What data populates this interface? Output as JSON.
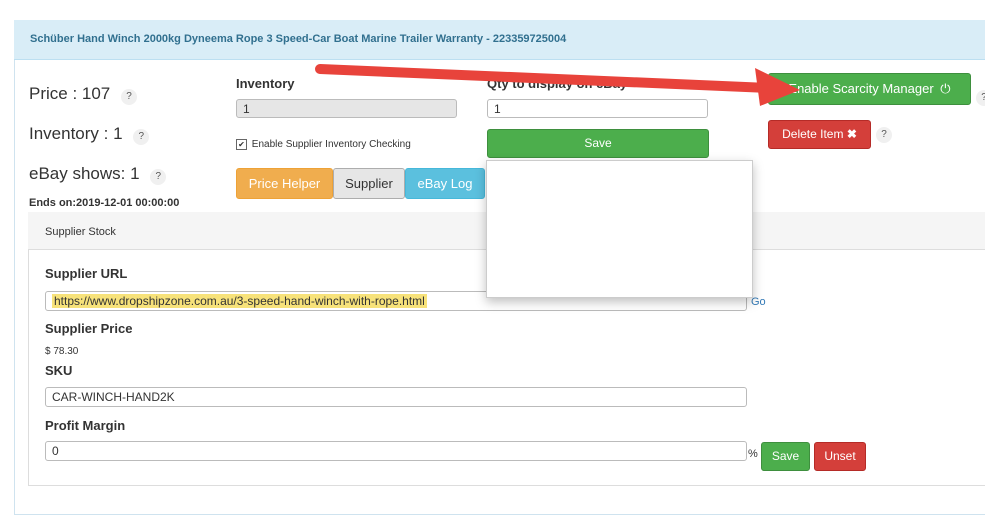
{
  "header": {
    "title": "Schüber Hand Winch 2000kg Dyneema Rope 3 Speed-Car Boat Marine Trailer Warranty - 223359725004"
  },
  "summary": {
    "price_text": "Price : 107",
    "inventory_text": "Inventory : 1",
    "ebay_shows_text": "eBay shows: 1",
    "help": "?",
    "ends_on": "Ends on:2019-12-01 00:00:00"
  },
  "inventory": {
    "label": "Inventory",
    "value": "1",
    "checkbox_label": "Enable Supplier Inventory Checking"
  },
  "qty": {
    "label": "Qty to display on eBay",
    "value": "1",
    "save_label": "Save"
  },
  "tabs": [
    "Price Helper",
    "Supplier",
    "eBay Log"
  ],
  "actions": {
    "scarcity_label": "Enable Scarcity Manager",
    "delete_label": "Delete Item"
  },
  "supplier": {
    "panel_title": "Supplier Stock",
    "url_label": "Supplier URL",
    "url_value": "https://www.dropshipzone.com.au/3-speed-hand-winch-with-rope.html",
    "go_label": "Go",
    "price_label": "Supplier Price",
    "price_value": "$ 78.30",
    "sku_label": "SKU",
    "sku_value": "CAR-WINCH-HAND2K",
    "margin_label": "Profit Margin",
    "margin_value": "0",
    "percent": "%",
    "save_label": "Save",
    "unset_label": "Unset"
  },
  "colors": {
    "header_bg": "#d9edf7",
    "header_text": "#31708f",
    "green": "#4cae4c",
    "red": "#d43f3a",
    "orange": "#f0ad4e",
    "blue": "#5bc0de",
    "arrow": "#e8433b",
    "highlight": "#f7e27a"
  },
  "icons": {
    "power": "power-icon",
    "close": "close-x-icon",
    "check": "checkbox-checked-icon"
  }
}
